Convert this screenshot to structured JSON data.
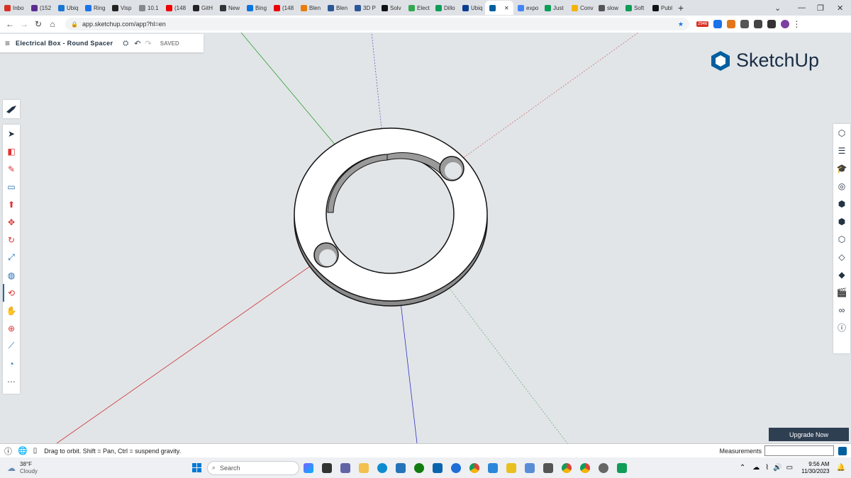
{
  "browser": {
    "tabs": [
      {
        "label": "Inbo",
        "color": "#d93025"
      },
      {
        "label": "(152",
        "color": "#5c2d91"
      },
      {
        "label": "Ubiq",
        "color": "#1976d2"
      },
      {
        "label": "Ring",
        "color": "#1a73e8"
      },
      {
        "label": "Visp",
        "color": "#222"
      },
      {
        "label": "10.1",
        "color": "#888"
      },
      {
        "label": "(148",
        "color": "#e00"
      },
      {
        "label": "GitH",
        "color": "#222"
      },
      {
        "label": "New",
        "color": "#333"
      },
      {
        "label": "Bing",
        "color": "#0b74de"
      },
      {
        "label": "(148",
        "color": "#e00"
      },
      {
        "label": "Blen",
        "color": "#e87d0d"
      },
      {
        "label": "Blen",
        "color": "#2b5797"
      },
      {
        "label": "3D P",
        "color": "#2b5797"
      },
      {
        "label": "Solv",
        "color": "#111"
      },
      {
        "label": "Elect",
        "color": "#34a853"
      },
      {
        "label": "Dillo",
        "color": "#0f9d58"
      },
      {
        "label": "Ubiq",
        "color": "#0b3d91"
      },
      {
        "label": "",
        "color": "#005f9e",
        "active": true
      },
      {
        "label": "expo",
        "color": "#4285f4"
      },
      {
        "label": "Just",
        "color": "#0f9d58"
      },
      {
        "label": "Conv",
        "color": "#f4b400"
      },
      {
        "label": "slow",
        "color": "#555"
      },
      {
        "label": "Soft",
        "color": "#0f9d58"
      },
      {
        "label": "Publ",
        "color": "#111"
      }
    ],
    "new_tab": "+",
    "url": "app.sketchup.com/app?hl=en",
    "badge": "2946"
  },
  "sketchup": {
    "doc_title": "Electrical Box - Round Spacer",
    "saved": "SAVED",
    "logo_text": "SketchUp",
    "upgrade_label": "Upgrade Now",
    "status_hint": "Drag to orbit. Shift = Pan, Ctrl = suspend gravity.",
    "measurements_label": "Measurements",
    "left_tools": [
      "select-icon",
      "eraser-icon",
      "pencil-icon",
      "rectangle-icon",
      "push-pull-icon",
      "move-icon",
      "rotate-icon",
      "scale-icon",
      "paint-bucket-icon",
      "orbit-icon",
      "pan-icon",
      "zoom-extents-icon",
      "tape-measure-icon",
      "protractor-icon",
      "more-icon"
    ],
    "right_tools": [
      "entity-info-icon",
      "outliner-icon",
      "instructor-icon",
      "components-icon",
      "materials-icon",
      "styles-icon",
      "tags-icon",
      "shadows-icon",
      "scenes-icon",
      "display-icon",
      "info-icon",
      "solar-icon"
    ],
    "colors": {
      "accent": "#005f9e",
      "upgrade_bg": "#2f3f52",
      "axis_red": "#d03030",
      "axis_green": "#30a030",
      "axis_blue": "#3030c0"
    }
  },
  "taskbar": {
    "weather_temp": "38°F",
    "weather_desc": "Cloudy",
    "search_placeholder": "Search",
    "time": "9:56 AM",
    "date": "11/30/2023"
  }
}
